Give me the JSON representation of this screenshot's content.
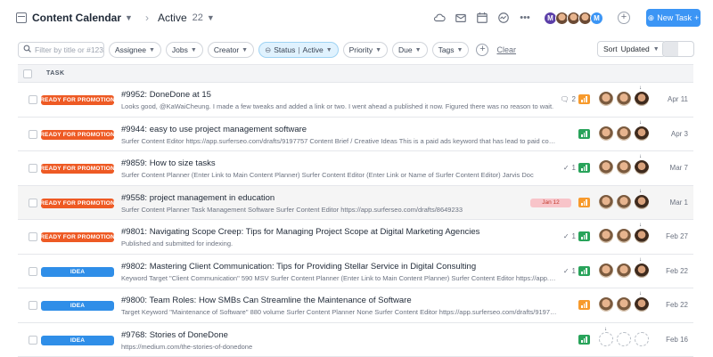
{
  "header": {
    "app_title": "Content Calendar",
    "view_name": "Active",
    "view_count": "22",
    "avatar_initials": [
      "M",
      "M"
    ],
    "new_task_label": "New Task",
    "accent_color": "#3b95f5"
  },
  "filters": {
    "search_placeholder": "Filter by title or #123...",
    "assignee": "Assignee",
    "jobs": "Jobs",
    "creator": "Creator",
    "status_label": "Status",
    "status_value": "Active",
    "priority": "Priority",
    "due": "Due",
    "tags": "Tags",
    "clear": "Clear",
    "sort_label": "Sort",
    "sort_value": "Updated"
  },
  "table": {
    "task_header": "TASK",
    "rows": [
      {
        "status": "READY FOR PROMOTION",
        "color": "orange",
        "title": "#9952: DoneDone at 15",
        "desc": "Looks good, @KaWaiCheung. I made a few tweaks and added a link or two. I went ahead a published it now. Figured there was no reason to wait.",
        "date_chip": "",
        "comments": "2",
        "checks": "",
        "priority": "orange",
        "date": "Apr 11"
      },
      {
        "status": "READY FOR PROMOTION",
        "color": "orange",
        "title": "#9944: easy to use project management software",
        "desc": "Surfer Content Editor https://app.surferseo.com/drafts/9197757 Content Brief / Creative Ideas This is a paid ads keyword that has lead to paid conversions",
        "date_chip": "",
        "comments": "",
        "checks": "",
        "priority": "green",
        "date": "Apr 3"
      },
      {
        "status": "READY FOR PROMOTION",
        "color": "orange",
        "title": "#9859: How to size tasks",
        "desc": "Surfer Content Planner (Enter Link to Main Content Planner) Surfer Content Editor (Enter Link or Name of Surfer Content Editor) Jarvis Doc",
        "date_chip": "",
        "comments": "",
        "checks": "1",
        "priority": "green",
        "date": "Mar 7"
      },
      {
        "status": "READY FOR PROMOTION",
        "color": "orange",
        "title": "#9558: project management in education",
        "desc": "Surfer Content Planner Task Management Software Surfer Content Editor https://app.surferseo.com/drafts/8649233",
        "date_chip": "Jan 12",
        "comments": "",
        "checks": "",
        "priority": "orange",
        "date": "Mar 1"
      },
      {
        "status": "READY FOR PROMOTION",
        "color": "orange",
        "title": "#9801: Navigating Scope Creep: Tips for Managing Project Scope at Digital Marketing Agencies",
        "desc": "Published and submitted for indexing.",
        "date_chip": "",
        "comments": "",
        "checks": "1",
        "priority": "green",
        "date": "Feb 27"
      },
      {
        "status": "IDEA",
        "color": "blue",
        "title": "#9802: Mastering Client Communication: Tips for Providing Stellar Service in Digital Consulting",
        "desc": "Keyword Target \"Client Communication\" 590 MSV Surfer Content Planner (Enter Link to Main Content Planner) Surfer Content Editor https://app.surferseo.com",
        "date_chip": "",
        "comments": "",
        "checks": "1",
        "priority": "green",
        "date": "Feb 22"
      },
      {
        "status": "IDEA",
        "color": "blue",
        "title": "#9800: Team Roles: How SMBs Can Streamline the Maintenance of Software",
        "desc": "Target Keyword \"Maintenance of Software\" 880 volume Surfer Content Planner None Surfer Content Editor https://app.surferseo.com/drafts/9197757",
        "date_chip": "",
        "comments": "",
        "checks": "",
        "priority": "orange",
        "date": "Feb 22"
      },
      {
        "status": "IDEA",
        "color": "blue",
        "title": "#9768: Stories of DoneDone",
        "desc": "https://medium.com/the-stories-of-donedone",
        "date_chip": "",
        "comments": "",
        "checks": "",
        "priority": "green",
        "date": "Feb 16"
      }
    ]
  }
}
